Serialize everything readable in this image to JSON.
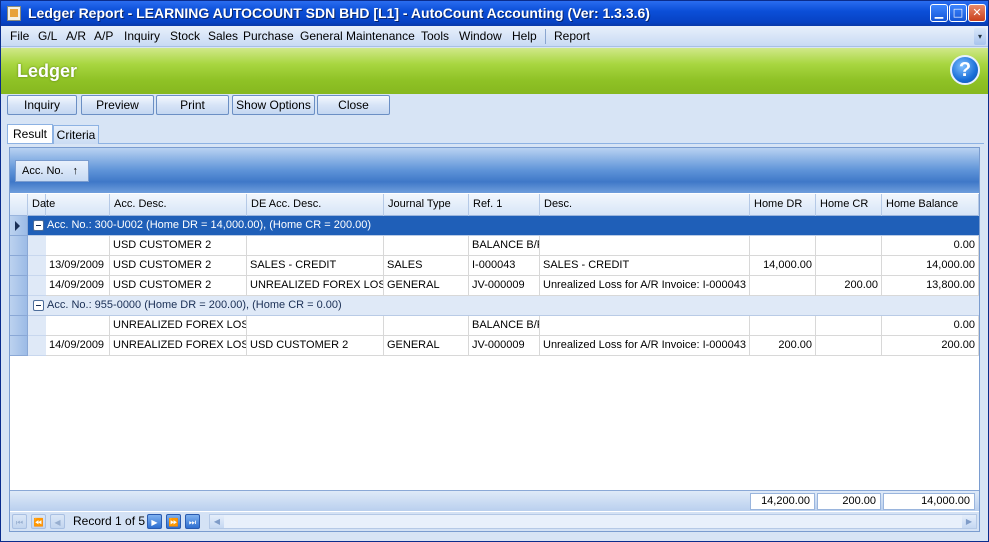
{
  "window": {
    "title": "Ledger Report - LEARNING AUTOCOUNT SDN BHD [L1] - AutoCount Accounting (Ver: 1.3.3.6)",
    "min_glyph": "▁",
    "max_glyph": "□",
    "close_glyph": "✕"
  },
  "menu": {
    "items": [
      "File",
      "G/L",
      "A/R",
      "A/P",
      "Inquiry",
      "Stock",
      "Sales",
      "Purchase",
      "General Maintenance",
      "Tools",
      "Window",
      "Help",
      "Report"
    ],
    "chevron": "▾"
  },
  "header": {
    "title": "Ledger",
    "help_glyph": "?"
  },
  "toolbar": {
    "inquiry": "Inquiry",
    "preview": "Preview",
    "print": "Print",
    "show_options": "Show Options",
    "close": "Close"
  },
  "tabs": {
    "result": "Result",
    "criteria": "Criteria"
  },
  "grid": {
    "group_chip": "Acc. No.",
    "group_chip_arrow": "↑",
    "columns": [
      "Date",
      "Acc. Desc.",
      "DE Acc. Desc.",
      "Journal Type",
      "Ref. 1",
      "Desc.",
      "Home DR",
      "Home CR",
      "Home Balance"
    ],
    "groups": [
      {
        "label": "Acc. No.: 300-U002 (Home DR = 14,000.00), (Home CR = 200.00)",
        "rows": [
          [
            "",
            "USD CUSTOMER 2",
            "",
            "",
            "BALANCE B/F",
            "",
            "",
            "",
            "0.00"
          ],
          [
            "13/09/2009",
            "USD CUSTOMER 2",
            "SALES - CREDIT",
            "SALES",
            "I-000043",
            "SALES - CREDIT",
            "14,000.00",
            "",
            "14,000.00"
          ],
          [
            "14/09/2009",
            "USD CUSTOMER 2",
            "UNREALIZED  FOREX LOSS",
            "GENERAL",
            "JV-000009",
            "Unrealized Loss for A/R Invoice: I-000043",
            "",
            "200.00",
            "13,800.00"
          ]
        ]
      },
      {
        "label": "Acc. No.: 955-0000 (Home DR = 200.00), (Home CR = 0.00)",
        "rows": [
          [
            "",
            "UNREALIZED  FOREX LOSS",
            "",
            "",
            "BALANCE B/F",
            "",
            "",
            "",
            "0.00"
          ],
          [
            "14/09/2009",
            "UNREALIZED  FOREX LOSS",
            "USD CUSTOMER 2",
            "GENERAL",
            "JV-000009",
            "Unrealized Loss for A/R Invoice: I-000043",
            "200.00",
            "",
            "200.00"
          ]
        ]
      }
    ],
    "totals": {
      "home_dr": "14,200.00",
      "home_cr": "200.00",
      "home_balance": "14,000.00"
    }
  },
  "navigator": {
    "record_text": "Record 1 of 5"
  }
}
